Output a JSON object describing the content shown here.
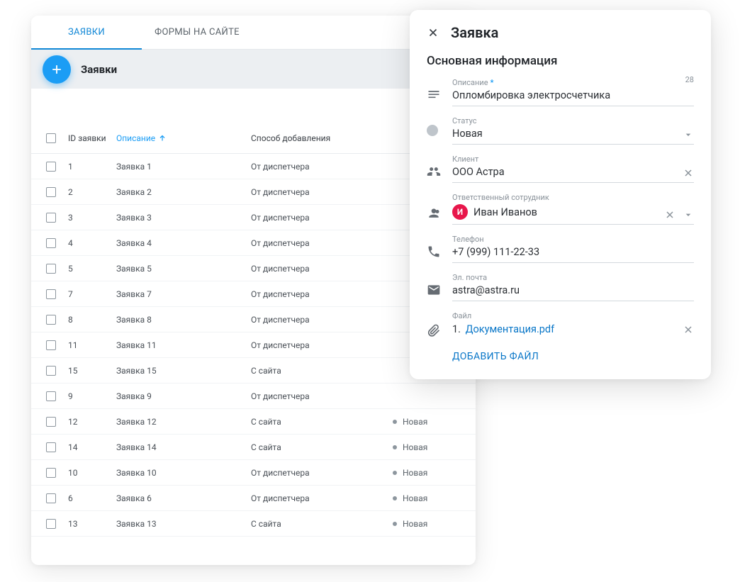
{
  "tabs": {
    "active": "ЗАЯВКИ",
    "inactive": "ФОРМЫ НА САЙТЕ"
  },
  "toolbar": {
    "title": "Заявки"
  },
  "table": {
    "headers": {
      "id": "ID заявки",
      "desc": "Описание",
      "method": "Способ добавления"
    },
    "rows": [
      {
        "id": "1",
        "desc": "Заявка 1",
        "method": "От диспетчера",
        "status": ""
      },
      {
        "id": "2",
        "desc": "Заявка 2",
        "method": "От диспетчера",
        "status": ""
      },
      {
        "id": "3",
        "desc": "Заявка 3",
        "method": "От диспетчера",
        "status": ""
      },
      {
        "id": "4",
        "desc": "Заявка 4",
        "method": "От диспетчера",
        "status": ""
      },
      {
        "id": "5",
        "desc": "Заявка 5",
        "method": "От диспетчера",
        "status": ""
      },
      {
        "id": "7",
        "desc": "Заявка 7",
        "method": "От диспетчера",
        "status": ""
      },
      {
        "id": "8",
        "desc": "Заявка 8",
        "method": "От диспетчера",
        "status": ""
      },
      {
        "id": "11",
        "desc": "Заявка 11",
        "method": "От диспетчера",
        "status": ""
      },
      {
        "id": "15",
        "desc": "Заявка 15",
        "method": "С сайта",
        "status": ""
      },
      {
        "id": "9",
        "desc": "Заявка 9",
        "method": "От диспетчера",
        "status": ""
      },
      {
        "id": "12",
        "desc": "Заявка 12",
        "method": "С сайта",
        "status": "Новая"
      },
      {
        "id": "14",
        "desc": "Заявка 14",
        "method": "С сайта",
        "status": "Новая"
      },
      {
        "id": "10",
        "desc": "Заявка 10",
        "method": "От диспетчера",
        "status": "Новая"
      },
      {
        "id": "6",
        "desc": "Заявка 6",
        "method": "От диспетчера",
        "status": "Новая"
      },
      {
        "id": "13",
        "desc": "Заявка 13",
        "method": "С сайта",
        "status": "Новая"
      }
    ]
  },
  "detail": {
    "title": "Заявка",
    "section": "Основная информация",
    "fields": {
      "description": {
        "label": "Описание",
        "value": "Опломбировка электросчетчика",
        "counter": "28"
      },
      "status": {
        "label": "Статус",
        "value": "Новая"
      },
      "client": {
        "label": "Клиент",
        "value": "ООО Астра"
      },
      "assignee": {
        "label": "Ответственный сотрудник",
        "value": "Иван Иванов",
        "initial": "И"
      },
      "phone": {
        "label": "Телефон",
        "value": "+7 (999) 111-22-33"
      },
      "email": {
        "label": "Эл. почта",
        "value": "astra@astra.ru"
      },
      "file": {
        "label": "Файл",
        "index": "1.",
        "name": "Документация.pdf"
      }
    },
    "add_file": "ДОБАВИТЬ ФАЙЛ"
  }
}
